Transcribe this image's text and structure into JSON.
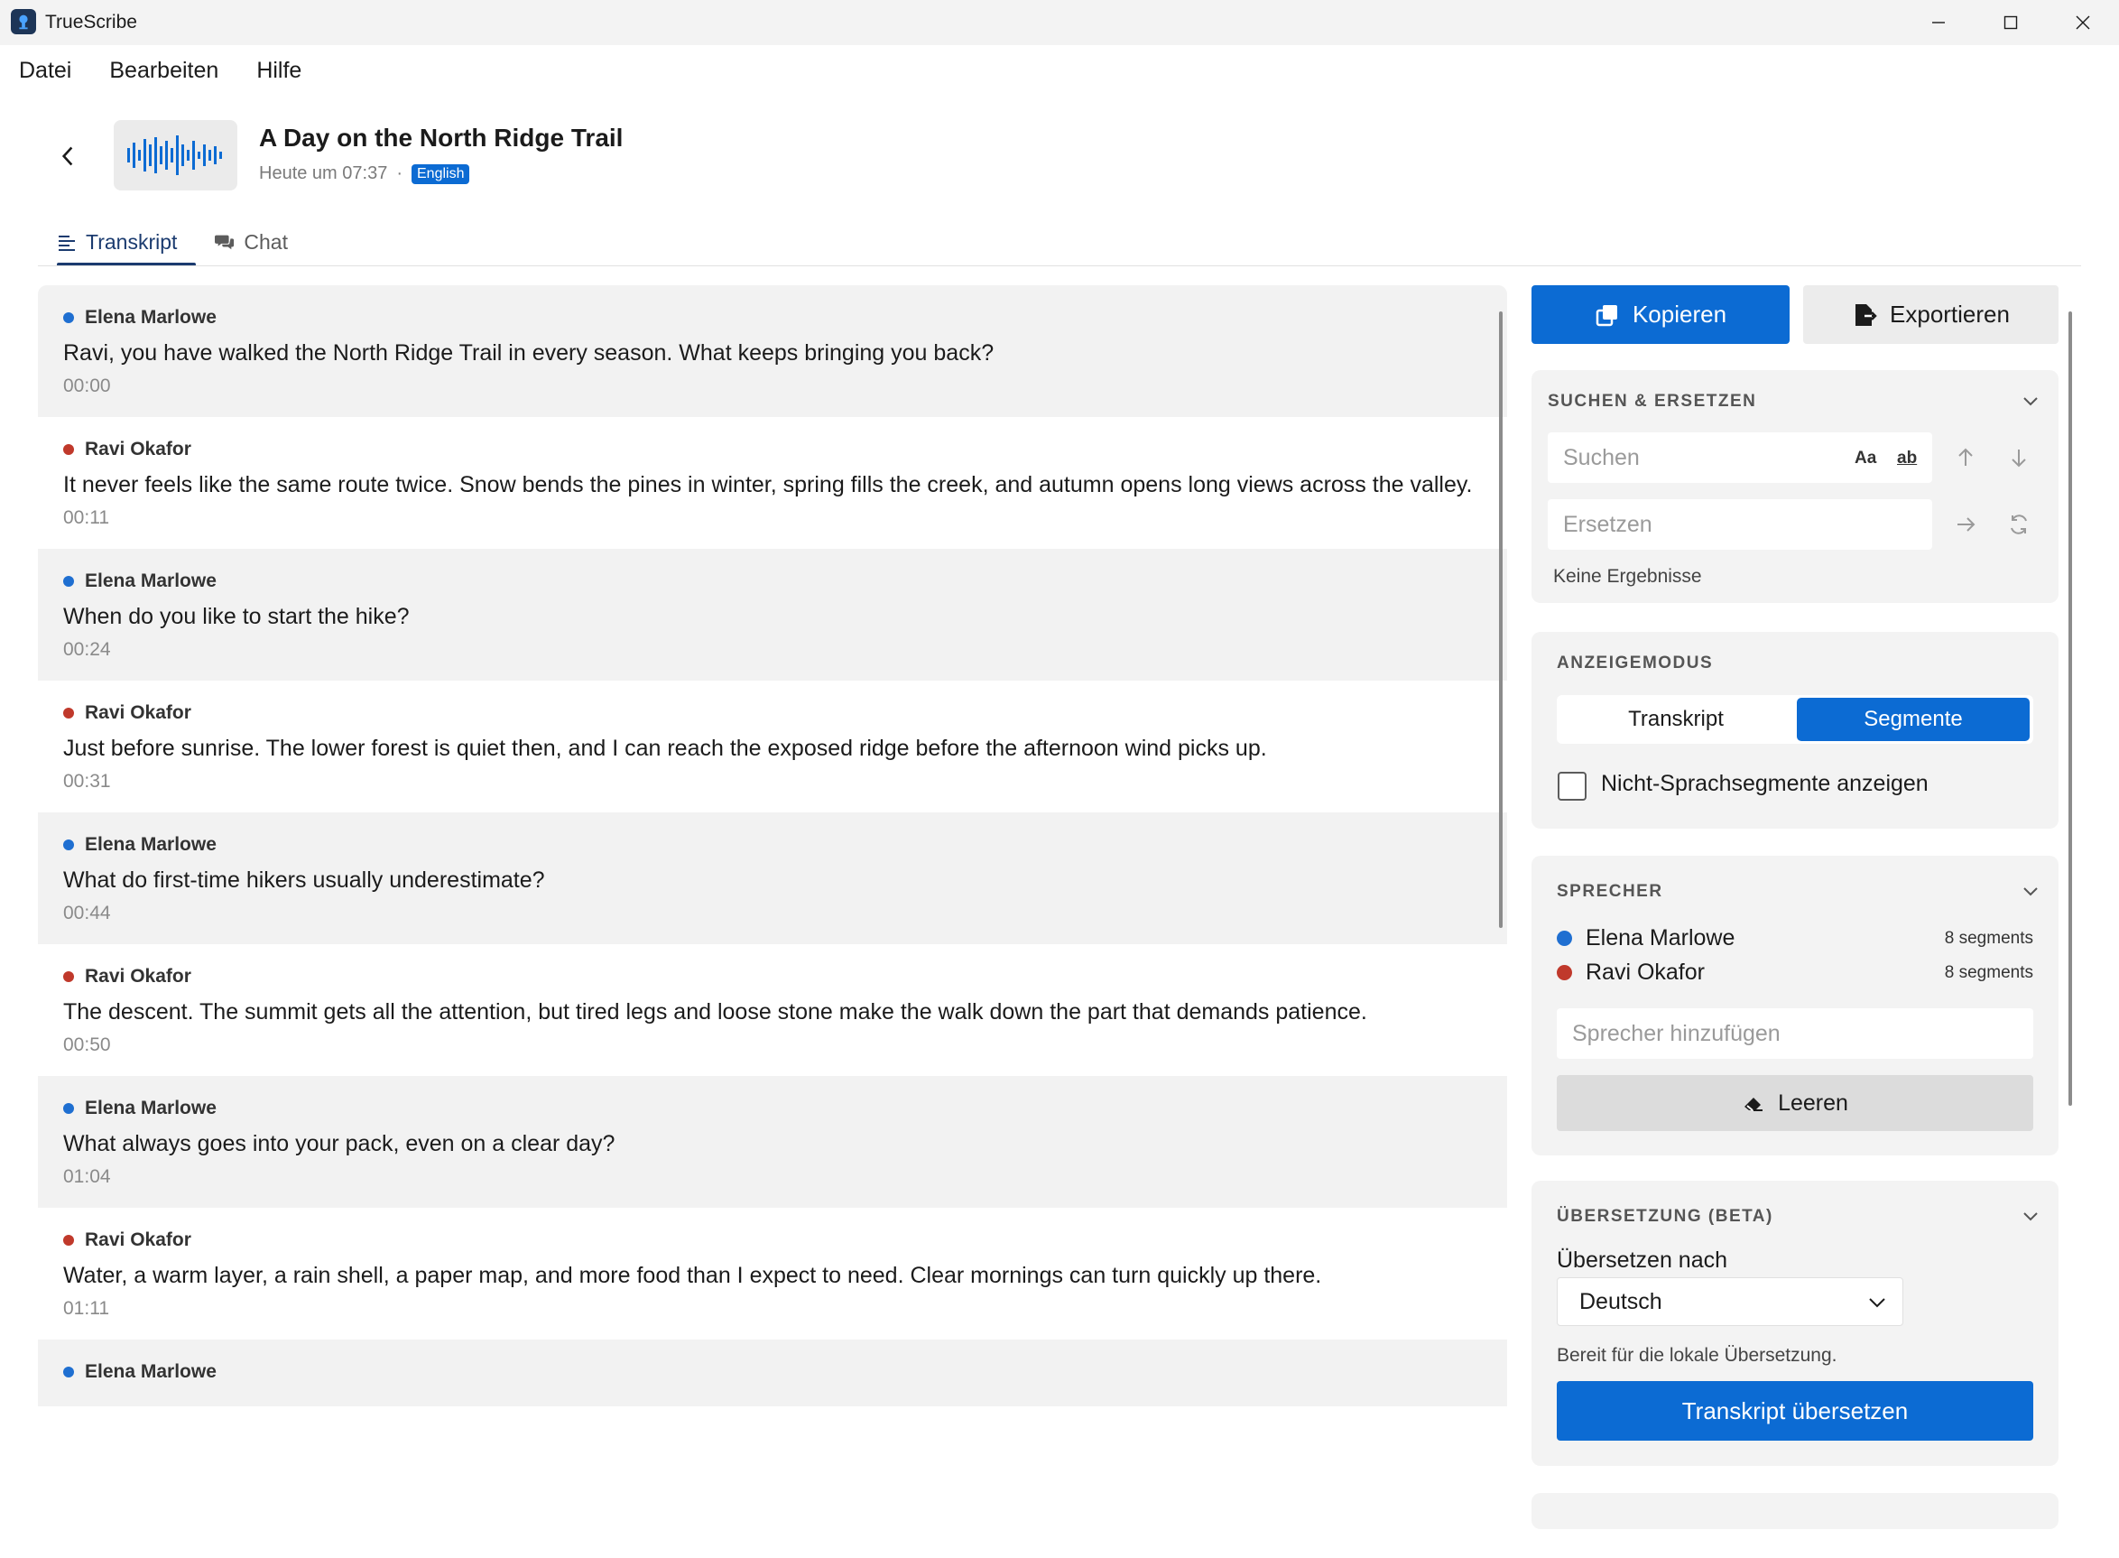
{
  "app": {
    "title": "TrueScribe"
  },
  "menu": [
    "Datei",
    "Bearbeiten",
    "Hilfe"
  ],
  "header": {
    "title": "A Day on the North Ridge Trail",
    "timestamp": "Heute um 07:37",
    "separator": "·",
    "language": "English"
  },
  "tabs": [
    {
      "label": "Transkript",
      "icon": "list-icon",
      "active": true
    },
    {
      "label": "Chat",
      "icon": "chat-bubbles-icon",
      "active": false
    }
  ],
  "colors": {
    "accent": "#0c6bd3",
    "speaker_a": "#1f6fd1",
    "speaker_b": "#c0392b"
  },
  "segments": [
    {
      "speaker": "Elena Marlowe",
      "color": "#1f6fd1",
      "text": "Ravi, you have walked the North Ridge Trail in every season. What keeps bringing you back?",
      "time": "00:00"
    },
    {
      "speaker": "Ravi Okafor",
      "color": "#c0392b",
      "text": "It never feels like the same route twice. Snow bends the pines in winter, spring fills the creek, and autumn opens long views across the valley.",
      "time": "00:11"
    },
    {
      "speaker": "Elena Marlowe",
      "color": "#1f6fd1",
      "text": "When do you like to start the hike?",
      "time": "00:24"
    },
    {
      "speaker": "Ravi Okafor",
      "color": "#c0392b",
      "text": "Just before sunrise. The lower forest is quiet then, and I can reach the exposed ridge before the afternoon wind picks up.",
      "time": "00:31"
    },
    {
      "speaker": "Elena Marlowe",
      "color": "#1f6fd1",
      "text": "What do first-time hikers usually underestimate?",
      "time": "00:44"
    },
    {
      "speaker": "Ravi Okafor",
      "color": "#c0392b",
      "text": "The descent. The summit gets all the attention, but tired legs and loose stone make the walk down the part that demands patience.",
      "time": "00:50"
    },
    {
      "speaker": "Elena Marlowe",
      "color": "#1f6fd1",
      "text": "What always goes into your pack, even on a clear day?",
      "time": "01:04"
    },
    {
      "speaker": "Ravi Okafor",
      "color": "#c0392b",
      "text": "Water, a warm layer, a rain shell, a paper map, and more food than I expect to need. Clear mornings can turn quickly up there.",
      "time": "01:11"
    },
    {
      "speaker": "Elena Marlowe",
      "color": "#1f6fd1",
      "text": "",
      "time": ""
    }
  ],
  "actions": {
    "copy": "Kopieren",
    "export": "Exportieren"
  },
  "search_replace": {
    "title": "SUCHEN & ERSETZEN",
    "search_placeholder": "Suchen",
    "case_toggle": "Aa",
    "word_toggle": "ab",
    "replace_placeholder": "Ersetzen",
    "status": "Keine Ergebnisse"
  },
  "display_mode": {
    "title": "ANZEIGEMODUS",
    "options": [
      "Transkript",
      "Segmente"
    ],
    "selected": "Segmente",
    "checkbox_label": "Nicht-Sprachsegmente anzeigen"
  },
  "speakers": {
    "title": "SPRECHER",
    "list": [
      {
        "name": "Elena Marlowe",
        "count": "8 segments",
        "color": "#1f6fd1"
      },
      {
        "name": "Ravi Okafor",
        "count": "8 segments",
        "color": "#c0392b"
      }
    ],
    "add_placeholder": "Sprecher hinzufügen",
    "clear_label": "Leeren"
  },
  "translation": {
    "title": "ÜBERSETZUNG (BETA)",
    "label": "Übersetzen nach",
    "selected_language": "Deutsch",
    "status": "Bereit für die lokale Übersetzung.",
    "button": "Transkript übersetzen"
  }
}
